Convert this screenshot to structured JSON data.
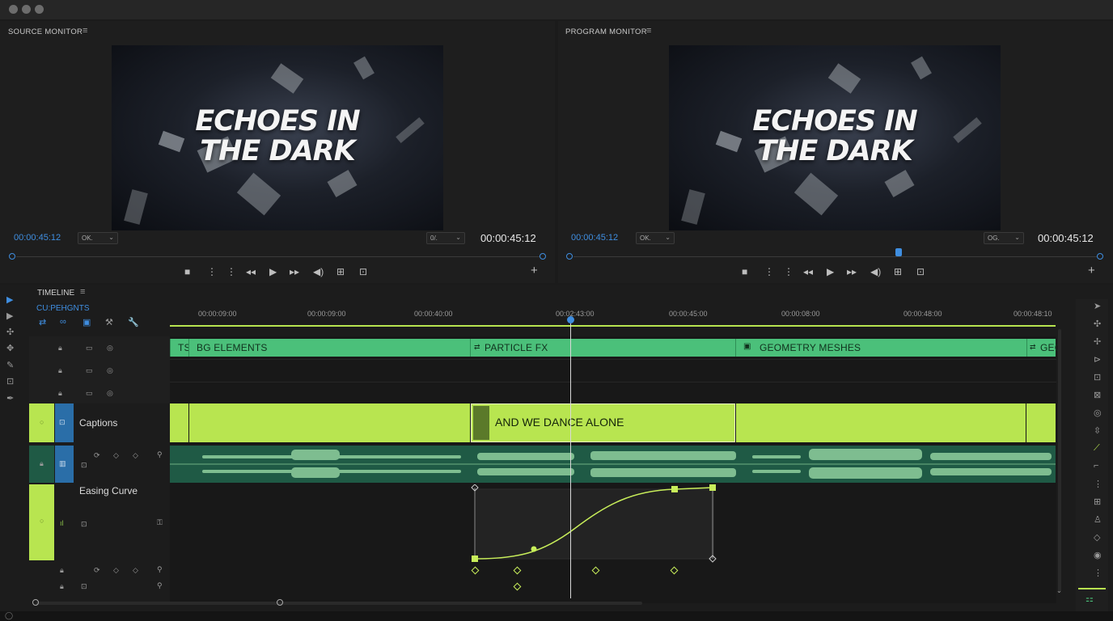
{
  "window": {
    "dots": 3
  },
  "source_monitor": {
    "title": "SOURCE MONITOR",
    "video_title_line1": "ECHOES IN",
    "video_title_line2": "THE DARK",
    "timecode_left": "00:00:45:12",
    "zoom_dropdown": "OK.",
    "quality_dropdown": "0/.",
    "timecode_right": "00:00:45:12"
  },
  "program_monitor": {
    "title": "PROGRAM MONITOR",
    "video_title_line1": "ECHOES IN",
    "video_title_line2": "THE DARK",
    "timecode_left": "00:00:45:12",
    "zoom_dropdown": "OK.",
    "quality_dropdown": "OG.",
    "timecode_right": "00:00:45:12"
  },
  "timeline": {
    "title": "TIMELINE",
    "sequence_label": "CU:PEHGNTS",
    "ruler": [
      "00:00:09:00",
      "00:00:09:00",
      "00:00:40:00",
      "00:02:43:00",
      "00:00:45:00",
      "00:00:08:00",
      "00:00:48:00",
      "00:00:48:10"
    ],
    "clips": {
      "ts": "TS",
      "bg": "BG ELEMENTS",
      "particle": "PARTICLE FX",
      "geometry": "GEOMETRY MESHES",
      "geo_tail": "GEC",
      "caption": "AND WE DANCE ALONE"
    },
    "tracks": {
      "captions": "Captions",
      "easing": "Easing Curve"
    }
  },
  "colors": {
    "accent_blue": "#3f8ee0",
    "clip_green": "#4bc07a",
    "clip_lime": "#b8e550",
    "audio_green": "#1f5a45",
    "curve": "#c8ee5a"
  },
  "icons": [
    "selection-tool-icon",
    "track-select-icon",
    "ripple-icon",
    "move-icon",
    "razor-icon",
    "slip-icon",
    "pen-icon",
    "play-icon",
    "stop-icon",
    "step-back-icon",
    "step-forward-icon",
    "audio-icon",
    "export-frame-icon",
    "add-icon",
    "lock-icon",
    "eye-icon",
    "keyframe-icon",
    "zoom-icon",
    "wrench-icon"
  ]
}
